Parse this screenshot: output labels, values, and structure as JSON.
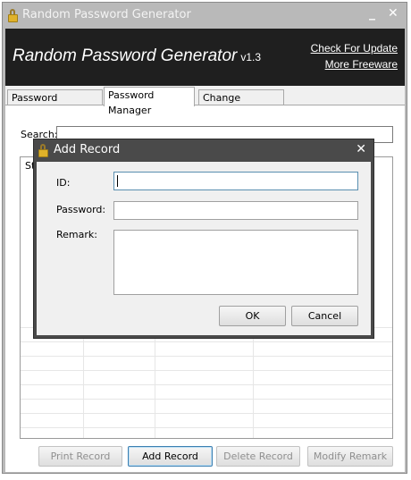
{
  "window": {
    "title": "Random Password Generator",
    "minimize_glyph": "_",
    "close_glyph": "✕"
  },
  "banner": {
    "title": "Random Password Generator",
    "version": "v1.3",
    "link_update": "Check For Update",
    "link_freeware": "More Freeware"
  },
  "tabs": [
    {
      "label": "Password Generator"
    },
    {
      "label": "Password Manager"
    },
    {
      "label": "Change Password"
    }
  ],
  "manager": {
    "search_label": "Search:",
    "search_value": "",
    "grid_header_partial": "St",
    "buttons": {
      "print": "Print Record",
      "add": "Add Record",
      "delete": "Delete Record",
      "modify": "Modify Remark"
    }
  },
  "dialog": {
    "title": "Add Record",
    "close_glyph": "✕",
    "id_label": "ID:",
    "id_value": "",
    "password_label": "Password:",
    "password_value": "",
    "remark_label": "Remark:",
    "remark_value": "",
    "ok_label": "OK",
    "cancel_label": "Cancel"
  },
  "colors": {
    "banner_bg": "#1f1f1f",
    "dialog_frame": "#4a4a4a",
    "lock_gold": "#e0b22a"
  }
}
